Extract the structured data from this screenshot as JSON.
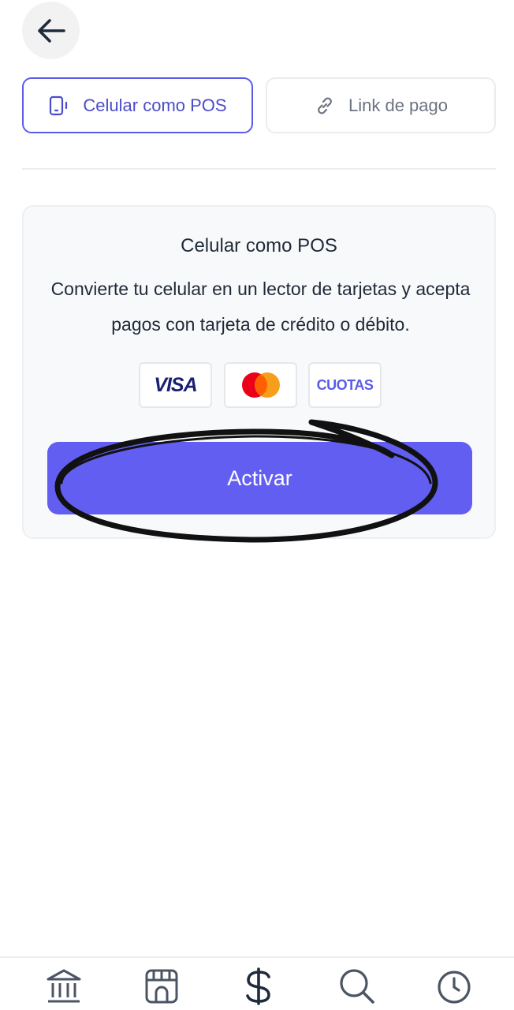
{
  "header": {
    "back_icon": "arrow-left-icon"
  },
  "tabs": [
    {
      "label": "Celular como POS",
      "icon": "phone-icon",
      "active": true
    },
    {
      "label": "Link de pago",
      "icon": "link-icon",
      "active": false
    }
  ],
  "card": {
    "title": "Celular como POS",
    "description": "Convierte tu celular en un lector de tarjetas y acepta pagos con tarjeta de crédito o débito.",
    "badges": {
      "visa": "VISA",
      "mastercard_icon": "mastercard-logo",
      "cuotas": "CUOTAS"
    },
    "button_label": "Activar"
  },
  "bottom_nav": [
    "bank-icon",
    "store-icon",
    "dollar-icon",
    "search-icon",
    "clock-icon"
  ],
  "colors": {
    "accent": "#625ef1",
    "tab_active_border": "#5b5bea",
    "text": "#1f2937"
  }
}
